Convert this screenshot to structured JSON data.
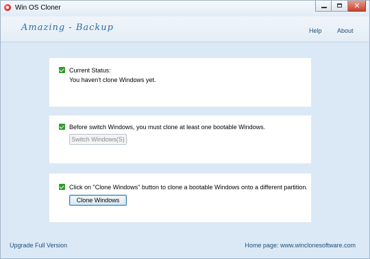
{
  "window": {
    "title": "Win OS Cloner",
    "close_glyph": "✕"
  },
  "header": {
    "logo_text": "Amazing - Backup",
    "nav": {
      "help": "Help",
      "about": "About"
    }
  },
  "status_panel": {
    "label": "Current Status:",
    "status": "You haven't clone Windows yet."
  },
  "switch_panel": {
    "message": "Before switch Windows, you must clone at least one bootable Windows.",
    "button_label": "Switch Windows(S)",
    "button_enabled": false
  },
  "clone_panel": {
    "message": "Click on \"Clone Windows\" button to clone a bootable Windows onto a different partition.",
    "button_label": "Clone Windows"
  },
  "footer": {
    "upgrade_link": "Upgrade Full Version",
    "homepage": "Home page: www.winclonesoftware.com"
  },
  "icons": {
    "app": "app-icon",
    "check": "check-icon",
    "minimize": "minimize-icon",
    "maximize": "maximize-icon",
    "close": "close-icon"
  }
}
